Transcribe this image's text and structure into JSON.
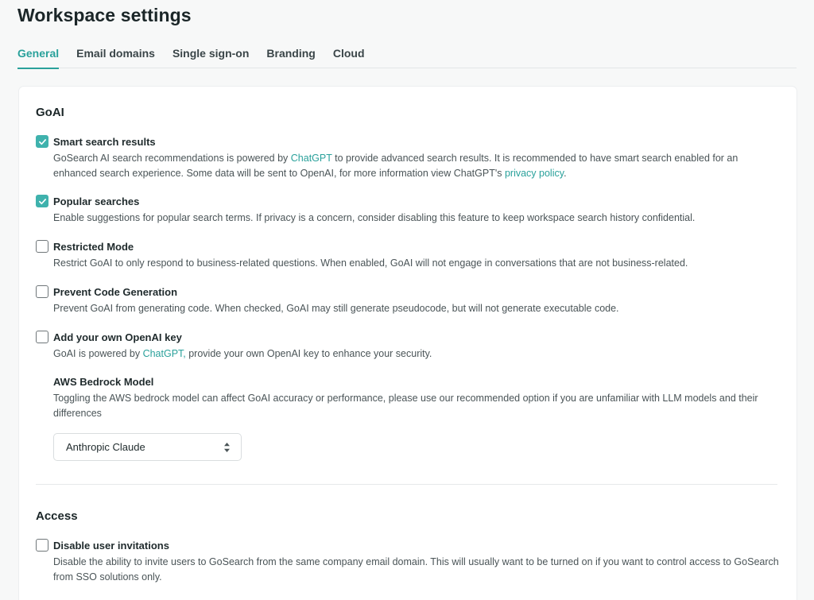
{
  "page": {
    "title": "Workspace settings"
  },
  "tabs": [
    {
      "label": "General",
      "active": true
    },
    {
      "label": "Email domains",
      "active": false
    },
    {
      "label": "Single sign-on",
      "active": false
    },
    {
      "label": "Branding",
      "active": false
    },
    {
      "label": "Cloud",
      "active": false
    }
  ],
  "goai": {
    "title": "GoAI",
    "smart_search": {
      "label": "Smart search results",
      "checked": true,
      "desc_1": "GoSearch AI search recommendations is powered by ",
      "link_chatgpt": "ChatGPT",
      "desc_2": " to provide advanced search results. It is recommended to have smart search enabled for an enhanced search experience. Some data will be sent to OpenAI, for more information view ChatGPT's ",
      "link_privacy": "privacy policy",
      "desc_3": "."
    },
    "popular_searches": {
      "label": "Popular searches",
      "checked": true,
      "desc": "Enable suggestions for popular search terms. If privacy is a concern, consider disabling this feature to keep workspace search history confidential."
    },
    "restricted_mode": {
      "label": "Restricted Mode",
      "checked": false,
      "desc": "Restrict GoAI to only respond to business-related questions. When enabled, GoAI will not engage in conversations that are not business-related."
    },
    "prevent_code": {
      "label": "Prevent Code Generation",
      "checked": false,
      "desc": "Prevent GoAI from generating code. When checked, GoAI may still generate pseudocode, but will not generate executable code."
    },
    "own_key": {
      "label": "Add your own OpenAI key",
      "checked": false,
      "desc_1": "GoAI is powered by ",
      "link_chatgpt": "ChatGPT,",
      "desc_2": " provide your own OpenAI key to enhance your security."
    },
    "bedrock": {
      "label": "AWS Bedrock Model",
      "desc": "Toggling the AWS bedrock model can affect GoAI accuracy or performance, please use our recommended option if you are unfamiliar with LLM models and their differences",
      "selected": "Anthropic Claude"
    }
  },
  "access": {
    "title": "Access",
    "disable_invites": {
      "label": "Disable user invitations",
      "checked": false,
      "desc": "Disable the ability to invite users to GoSearch from the same company email domain. This will usually want to be turned on if you want to control access to GoSearch from SSO solutions only."
    }
  },
  "colors": {
    "accent": "#2aa19b",
    "checkbox_fill": "#3fb2ad"
  }
}
